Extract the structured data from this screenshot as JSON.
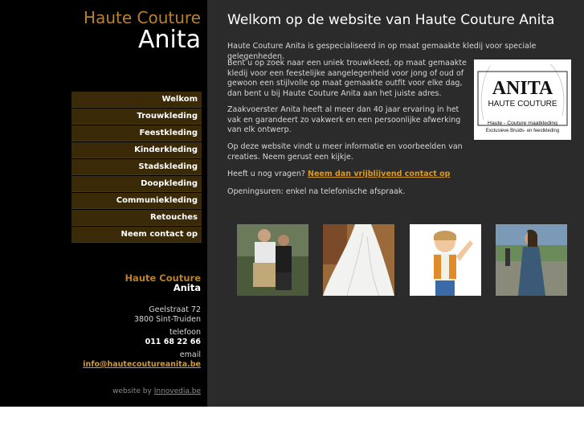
{
  "brand": {
    "line1": "Haute Couture",
    "line2": "Anita"
  },
  "nav": [
    "Welkom",
    "Trouwkleding",
    "Feestkleding",
    "Kinderkleding",
    "Stadskleding",
    "Doopkleding",
    "Communiekleding",
    "Retouches",
    "Neem contact op"
  ],
  "address": {
    "name1": "Haute Couture",
    "name2": "Anita",
    "street": "Geelstraat 72",
    "city": "3800 Sint-Truiden",
    "phone_label": "telefoon",
    "phone": "011 68 22 66",
    "email_label": "email",
    "email": "info@hautecoutureanita.be"
  },
  "credit": {
    "prefix": "website by",
    "link": "Innovedia.be"
  },
  "main": {
    "title": "Welkom op de website van Haute Couture Anita",
    "p1": "Haute Couture Anita is gespecialiseerd in op maat gemaakte kledij voor speciale gelegenheden.",
    "p2": "Bent u op zoek naar een uniek trouwkleed, op maat gemaakte kledij voor een feestelijke aangelegenheid voor jong of oud of gewoon een stijlvolle op maat gemaakte outfit voor elke dag, dan bent u bij Haute Couture Anita aan het juiste adres.",
    "p3": "Zaakvoerster Anita heeft al meer dan 40 jaar ervaring in het vak en garandeert zo vakwerk en een persoonlijke afwerking van elk ontwerp.",
    "p4": "Op deze website vindt u meer informatie en voorbeelden van creaties. Neem gerust een kijkje.",
    "p5_prefix": "Heeft u nog vragen? ",
    "p5_link": "Neem dan vrijblijvend contact op",
    "p6": "Openingsuren: enkel na telefonische afspraak."
  },
  "logo": {
    "name": "ANITA",
    "sub": "HAUTE COUTURE",
    "line1": "Haute - Couture  maatkleding",
    "line2": "Exclusieve Bruids- en feestkleding"
  },
  "colors": {
    "sidebar": "#000000",
    "content": "#2b2b2b",
    "accent": "#b8822c",
    "nav_bg": "#3a2a08",
    "link": "#d49a2c"
  }
}
